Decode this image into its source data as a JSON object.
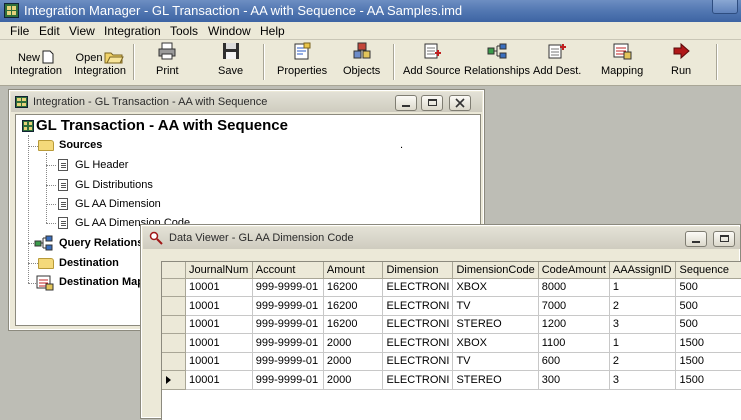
{
  "app": {
    "title": "Integration Manager - GL Transaction - AA with Sequence - AA Samples.imd"
  },
  "menu": [
    "File",
    "Edit",
    "View",
    "Integration",
    "Tools",
    "Window",
    "Help"
  ],
  "toolbar": {
    "new": [
      "New",
      "Integration"
    ],
    "open": [
      "Open",
      "Integration"
    ],
    "print": "Print",
    "save": "Save",
    "properties": "Properties",
    "objects": "Objects",
    "add_source": "Add Source",
    "relationships": "Relationships",
    "add_dest": "Add Dest.",
    "mapping": "Mapping",
    "run": "Run"
  },
  "integration_window": {
    "title": "Integration - GL Transaction - AA with Sequence",
    "root": "GL Transaction - AA with Sequence",
    "sources_label": "Sources",
    "sources": [
      "GL Header",
      "GL Distributions",
      "GL AA Dimension",
      "GL AA Dimension Code"
    ],
    "query_relationships": "Query Relationships",
    "destination": "Destination",
    "destination_mapping": "Destination Mapping",
    "dot": "."
  },
  "data_viewer": {
    "title": "Data Viewer - GL AA Dimension Code",
    "columns": [
      "JournalNum",
      "Account",
      "Amount",
      "Dimension",
      "DimensionCode",
      "CodeAmount",
      "AAAssignID",
      "Sequence"
    ],
    "rows": [
      [
        "10001",
        "999-9999-01",
        "16200",
        "ELECTRONI",
        "XBOX",
        "8000",
        "1",
        "500"
      ],
      [
        "10001",
        "999-9999-01",
        "16200",
        "ELECTRONI",
        "TV",
        "7000",
        "2",
        "500"
      ],
      [
        "10001",
        "999-9999-01",
        "16200",
        "ELECTRONI",
        "STEREO",
        "1200",
        "3",
        "500"
      ],
      [
        "10001",
        "999-9999-01",
        "2000",
        "ELECTRONI",
        "XBOX",
        "1100",
        "1",
        "1500"
      ],
      [
        "10001",
        "999-9999-01",
        "2000",
        "ELECTRONI",
        "TV",
        "600",
        "2",
        "1500"
      ],
      [
        "10001",
        "999-9999-01",
        "2000",
        "ELECTRONI",
        "STEREO",
        "300",
        "3",
        "1500"
      ]
    ],
    "current_row_index": 5
  },
  "colors": {
    "title_bar": "#5479b3",
    "chrome": "#ece9d8",
    "run_arrow": "#b01818"
  }
}
